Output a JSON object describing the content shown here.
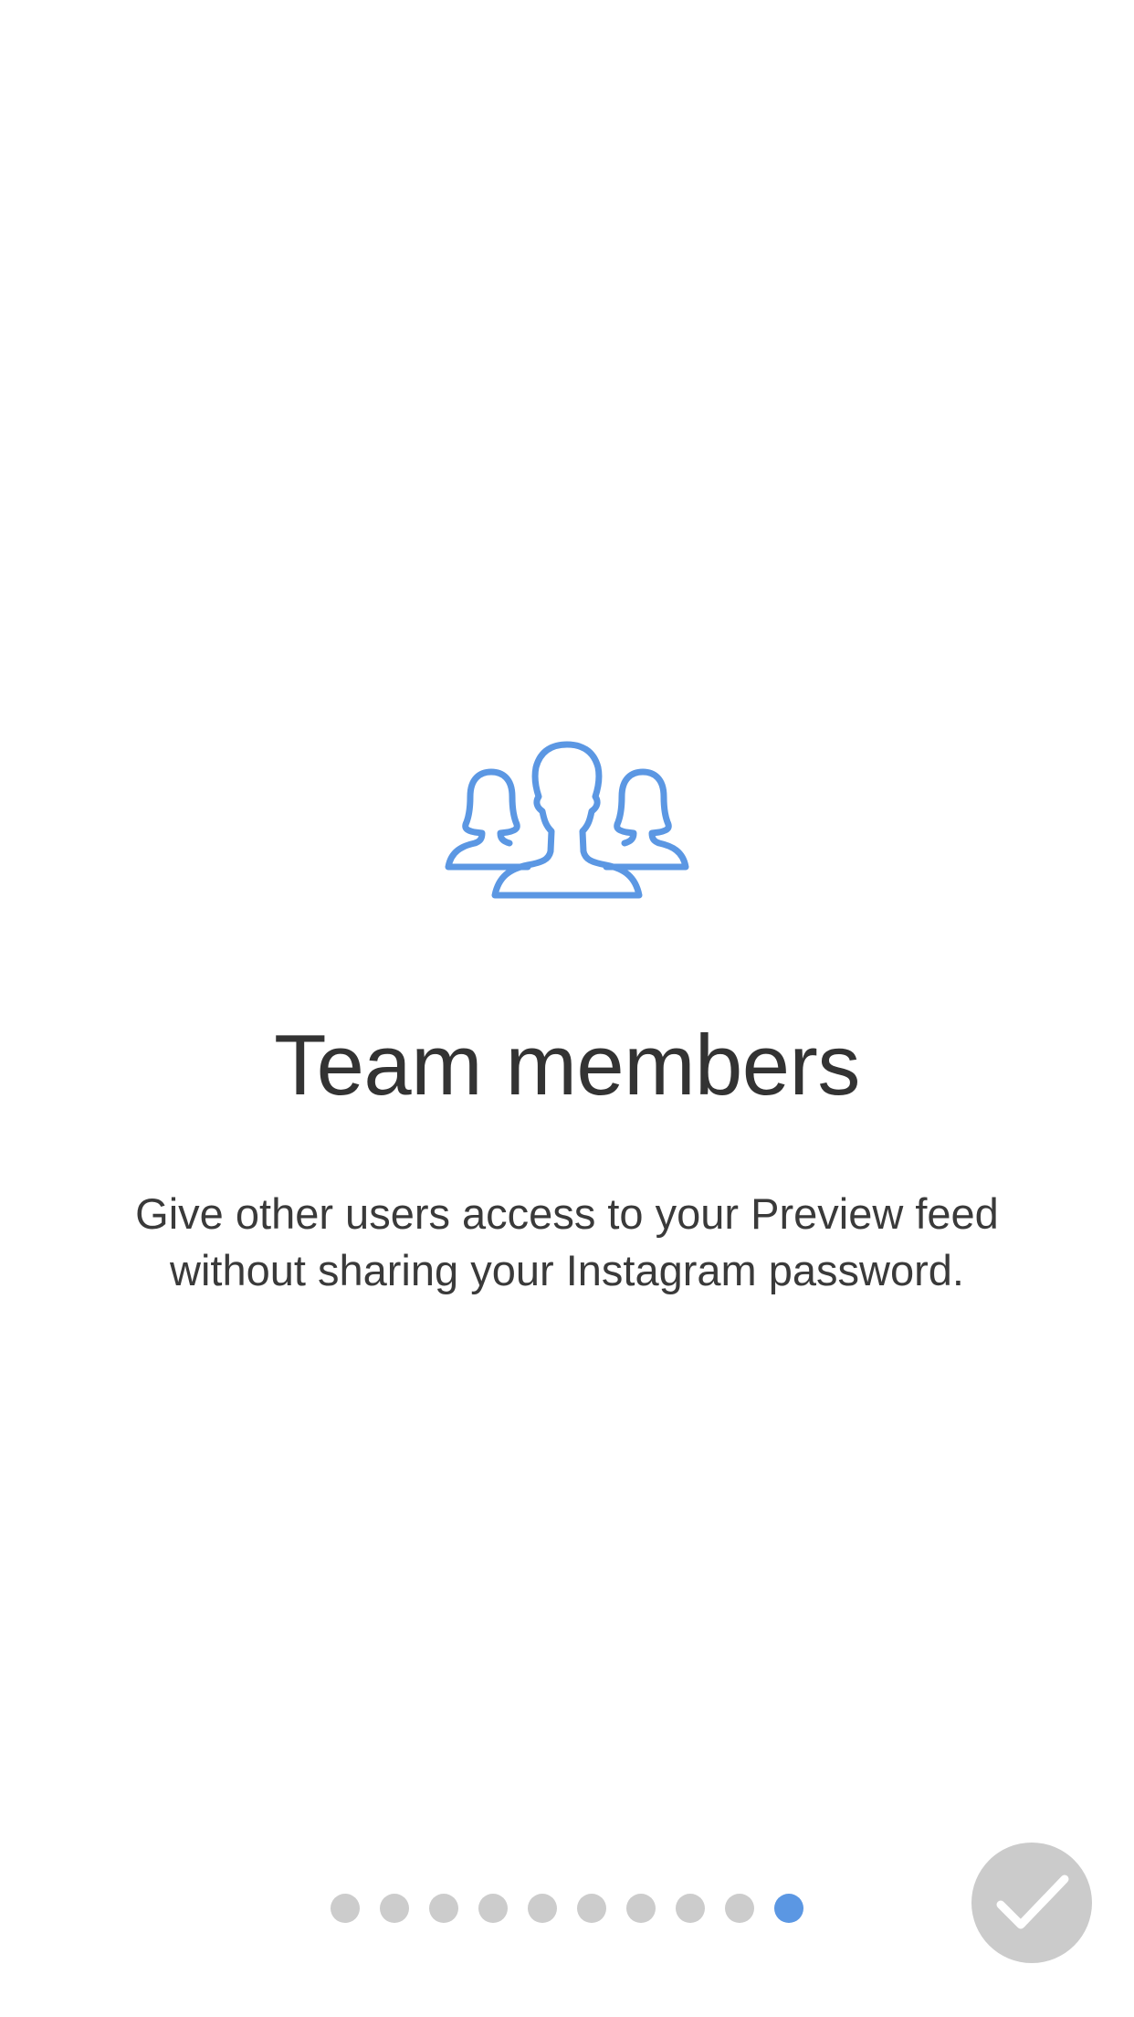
{
  "onboarding": {
    "icon": "team-members-icon",
    "title": "Team members",
    "description": "Give other users access to your Preview feed without sharing your Instagram password."
  },
  "pager": {
    "total_pages": 10,
    "current_page": 10
  },
  "done_button": {
    "icon": "checkmark-icon"
  },
  "colors": {
    "accent": "#5B97E3",
    "text": "#333333",
    "inactive_dot": "#CCCCCC",
    "button_bg": "#CBCBCB"
  }
}
